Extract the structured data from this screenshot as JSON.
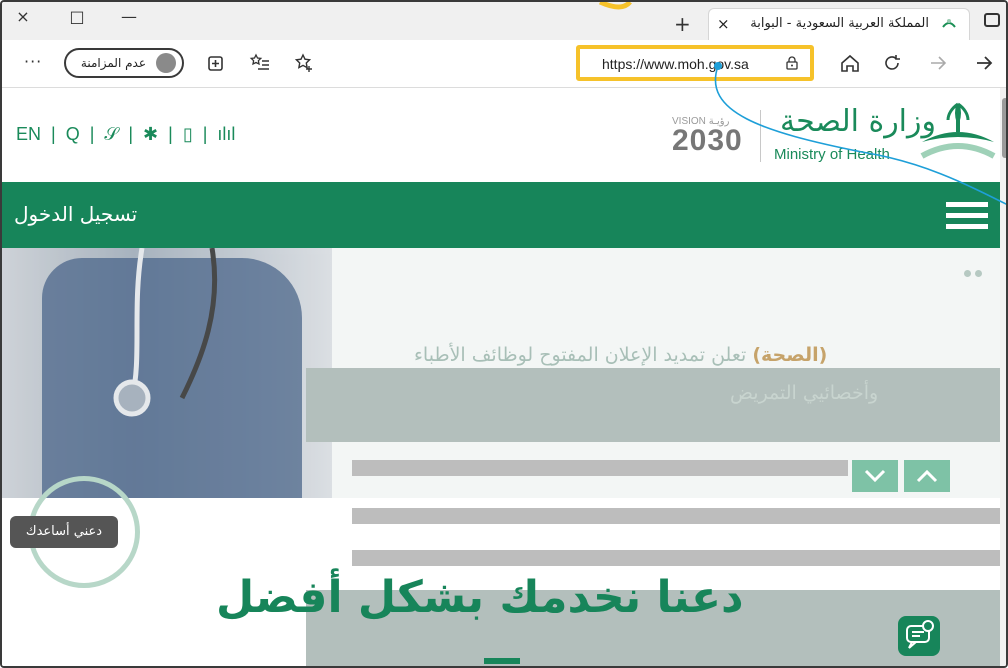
{
  "browser": {
    "tab_title": "المملكة العربية السعودية - البوابة",
    "tab_close": "×",
    "new_tab": "+",
    "window_close": "×",
    "window_restore": "□",
    "window_minimize": "—",
    "url": "https://www.moh.gov.sa",
    "profile_label": "عدم المزامنة",
    "more_menu": "···"
  },
  "site": {
    "util_links": [
      "EN",
      "|",
      "Q",
      "|",
      "𝒮",
      "|",
      "✱",
      "|",
      "▯",
      "|",
      "ılıl"
    ],
    "vision_top": "VISION رؤيـة",
    "vision_year": "2030",
    "org_name_ar": "وزارة الصحة",
    "org_name_en": "Ministry of Health",
    "login_label": "تسجيل الدخول",
    "headline_highlight": "(الصحة)",
    "headline_line1": " تعلن تمديد الإعلان المفتوح لوظائف الأطباء",
    "headline_line2": "وأخصائيي التمريض",
    "help_label": "دعني أساعدك",
    "big_title": "دعنا نخدمك بشكل أفضل"
  },
  "colors": {
    "brand_green": "#17855a",
    "highlight_yellow": "#f6c22a",
    "annotation_blue": "#1e9fd8"
  }
}
